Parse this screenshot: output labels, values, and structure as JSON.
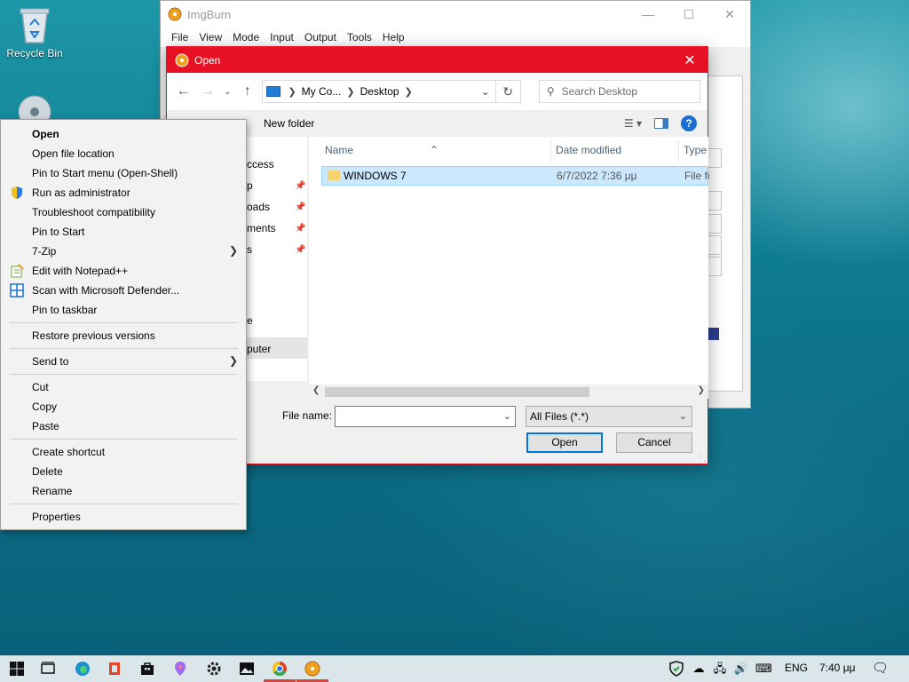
{
  "desktop": {
    "recycle_bin_label": "Recycle Bin"
  },
  "imgburn": {
    "title": "ImgBurn",
    "menu": [
      "File",
      "View",
      "Mode",
      "Input",
      "Output",
      "Tools",
      "Help"
    ]
  },
  "open_dialog": {
    "title": "Open",
    "address": {
      "crumbs": [
        "My Co...",
        "Desktop"
      ]
    },
    "search_placeholder": "Search Desktop",
    "new_folder": "New folder",
    "nav_items": [
      "ccess",
      "p",
      "oads",
      "ments",
      "s",
      "e",
      "puter"
    ],
    "columns": {
      "name": "Name",
      "date_modified": "Date modified",
      "type": "Type"
    },
    "files": [
      {
        "name": "WINDOWS 7",
        "date": "6/7/2022 7:36 μμ",
        "type": "File fo"
      }
    ],
    "file_name_label": "File name:",
    "file_name_value": "",
    "file_type": "All Files (*.*)",
    "open_button": "Open",
    "cancel_button": "Cancel"
  },
  "context_menu": {
    "items": [
      "Open",
      "Open file location",
      "Pin to Start menu (Open-Shell)",
      "Run as administrator",
      "Troubleshoot compatibility",
      "Pin to Start",
      "7-Zip",
      "Edit with Notepad++",
      "Scan with Microsoft Defender...",
      "Pin to taskbar",
      "Restore previous versions",
      "Send to",
      "Cut",
      "Copy",
      "Paste",
      "Create shortcut",
      "Delete",
      "Rename",
      "Properties"
    ]
  },
  "taskbar": {
    "language": "ENG",
    "clock": "7:40 μμ"
  },
  "colors": {
    "dialog_accent": "#e81123",
    "selection": "#cce8ff",
    "taskbar": "#dbe6ea"
  }
}
